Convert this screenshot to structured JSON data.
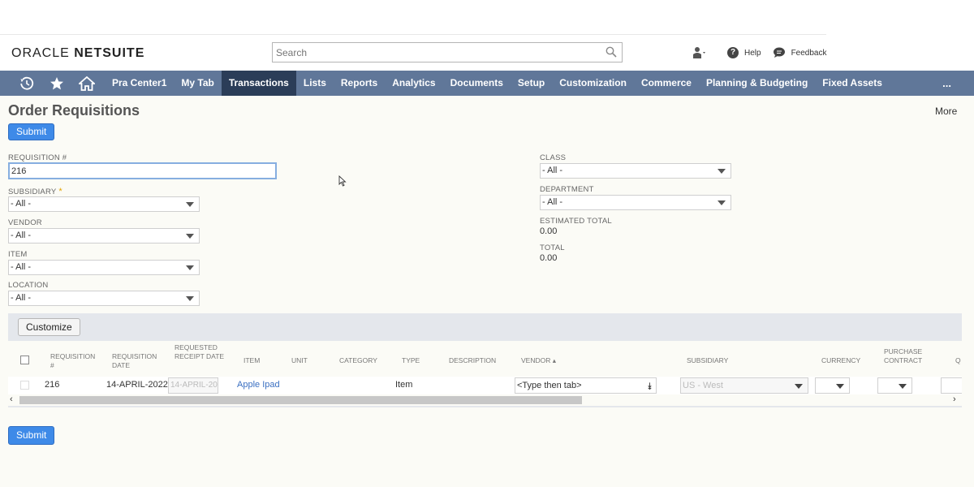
{
  "header": {
    "logo_brand": "ORACLE",
    "logo_product": "NETSUITE",
    "search_placeholder": "Search",
    "help_label": "Help",
    "feedback_label": "Feedback"
  },
  "nav": {
    "tabs": [
      {
        "label": "Pra Center1"
      },
      {
        "label": "My Tab"
      },
      {
        "label": "Transactions",
        "active": true
      },
      {
        "label": "Lists"
      },
      {
        "label": "Reports"
      },
      {
        "label": "Analytics"
      },
      {
        "label": "Documents"
      },
      {
        "label": "Setup"
      },
      {
        "label": "Customization"
      },
      {
        "label": "Commerce"
      },
      {
        "label": "Planning & Budgeting"
      },
      {
        "label": "Fixed Assets"
      }
    ],
    "overflow_label": "..."
  },
  "page": {
    "title": "Order Requisitions",
    "more_label": "More",
    "submit_label": "Submit"
  },
  "form": {
    "requisition_label": "REQUISITION #",
    "requisition_value": "216",
    "subsidiary_label": "SUBSIDIARY",
    "subsidiary_value": "- All -",
    "vendor_label": "VENDOR",
    "vendor_value": "- All -",
    "item_label": "ITEM",
    "item_value": "- All -",
    "location_label": "LOCATION",
    "location_value": "- All -",
    "class_label": "CLASS",
    "class_value": "- All -",
    "department_label": "DEPARTMENT",
    "department_value": "- All -",
    "estimated_total_label": "ESTIMATED TOTAL",
    "estimated_total_value": "0.00",
    "total_label": "TOTAL",
    "total_value": "0.00"
  },
  "grid": {
    "customize_label": "Customize",
    "columns": {
      "requisition_num": "REQUISITION #",
      "requisition_date": "REQUISITION DATE",
      "requested_receipt_date": "REQUESTED RECEIPT DATE",
      "item": "ITEM",
      "unit": "UNIT",
      "category": "CATEGORY",
      "type": "TYPE",
      "description": "DESCRIPTION",
      "vendor": "VENDOR ▴",
      "subsidiary": "SUBSIDIARY",
      "currency": "CURRENCY",
      "purchase_contract": "PURCHASE CONTRACT",
      "q": "Q"
    },
    "row": {
      "requisition_num": "216",
      "requisition_date": "14-APRIL-2022",
      "requested_receipt_date": "14-APRIL-20",
      "item": "Apple Ipad",
      "type": "Item",
      "vendor_placeholder": "<Type then tab>",
      "subsidiary": "US - West"
    }
  },
  "colors": {
    "nav_bg": "#607799",
    "nav_active": "#2b3d58",
    "primary_button": "#3e8ae8",
    "link": "#3a6fc1"
  }
}
